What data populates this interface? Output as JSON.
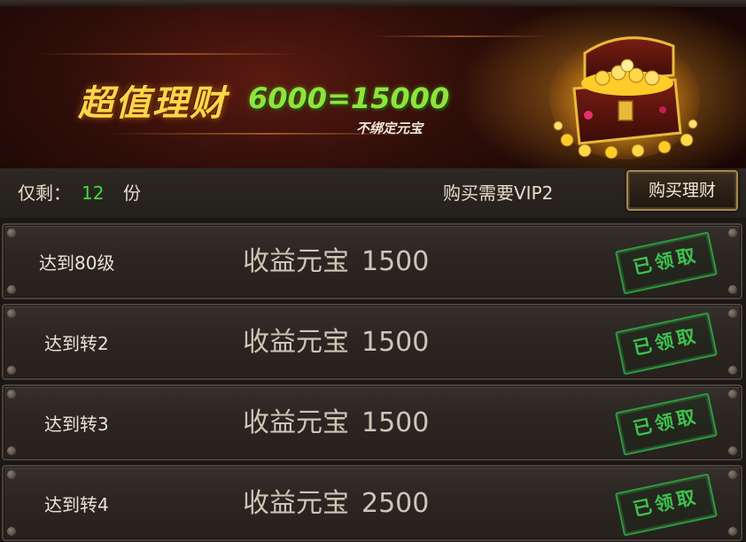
{
  "banner": {
    "title": "超值理财",
    "formula": "6000=15000",
    "subtitle": "不绑定元宝",
    "image_icon": "treasure-chest-icon"
  },
  "info": {
    "remain_label": "仅剩：",
    "remain_count": "12",
    "remain_unit": "份",
    "vip_requirement": "购买需要VIP2",
    "buy_button": "购买理财"
  },
  "rows": [
    {
      "condition": "达到80级",
      "reward_label": "收益元宝",
      "amount": "1500",
      "status": "已领取"
    },
    {
      "condition": "达到转2",
      "reward_label": "收益元宝",
      "amount": "1500",
      "status": "已领取"
    },
    {
      "condition": "达到转3",
      "reward_label": "收益元宝",
      "amount": "1500",
      "status": "已领取"
    },
    {
      "condition": "达到转4",
      "reward_label": "收益元宝",
      "amount": "2500",
      "status": "已领取"
    }
  ],
  "colors": {
    "title_gold": "#ffd64a",
    "formula_green": "#8fe33c",
    "count_green": "#3fdc3c",
    "stamp_green": "#3cc24f"
  }
}
